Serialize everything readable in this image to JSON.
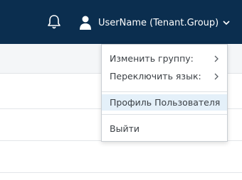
{
  "header": {
    "username": "UserName (Tenant.Group)",
    "icons": {
      "notifications": "bell-icon",
      "user": "user-icon",
      "dropdown": "chevron-down-icon"
    }
  },
  "menu": {
    "items": [
      {
        "label": "Изменить группу:",
        "has_submenu": true
      },
      {
        "label": "Переключить язык:",
        "has_submenu": true
      },
      {
        "label": "Профиль Пользователя",
        "has_submenu": false,
        "highlighted": true
      },
      {
        "label": "Выйти",
        "has_submenu": false
      }
    ]
  },
  "colors": {
    "topbar": "#0b2e4f",
    "highlight": "#e4f0f9",
    "text": "#3a3f44"
  }
}
